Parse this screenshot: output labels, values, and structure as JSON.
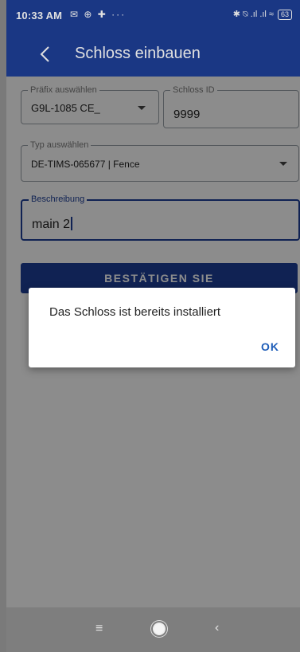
{
  "status_bar": {
    "time": "10:33 AM",
    "left_icons": "✉ ⊕ ✚ ···",
    "right_icons": "✱ ⍉ .ıl .ıl ≈",
    "battery": "63"
  },
  "app_bar": {
    "title": "Schloss einbauen",
    "back_icon": "chevron-left-icon"
  },
  "form": {
    "prefix": {
      "label": "Präfix auswählen",
      "value": "G9L-1085 CE_"
    },
    "lock_id": {
      "label": "Schloss ID",
      "value": "9999"
    },
    "type": {
      "label": "Typ auswählen",
      "value": "DE-TIMS-065677 | Fence"
    },
    "description": {
      "label": "Beschreibung",
      "value": "main 2"
    },
    "confirm_label": "BESTÄTIGEN SIE"
  },
  "dialog": {
    "message": "Das Schloss ist bereits installiert",
    "ok_label": "OK"
  },
  "nav_bar": {
    "menu": "≡",
    "back": "‹"
  },
  "colors": {
    "primary": "#1e3f97",
    "dialog_action": "#1e5db8"
  }
}
